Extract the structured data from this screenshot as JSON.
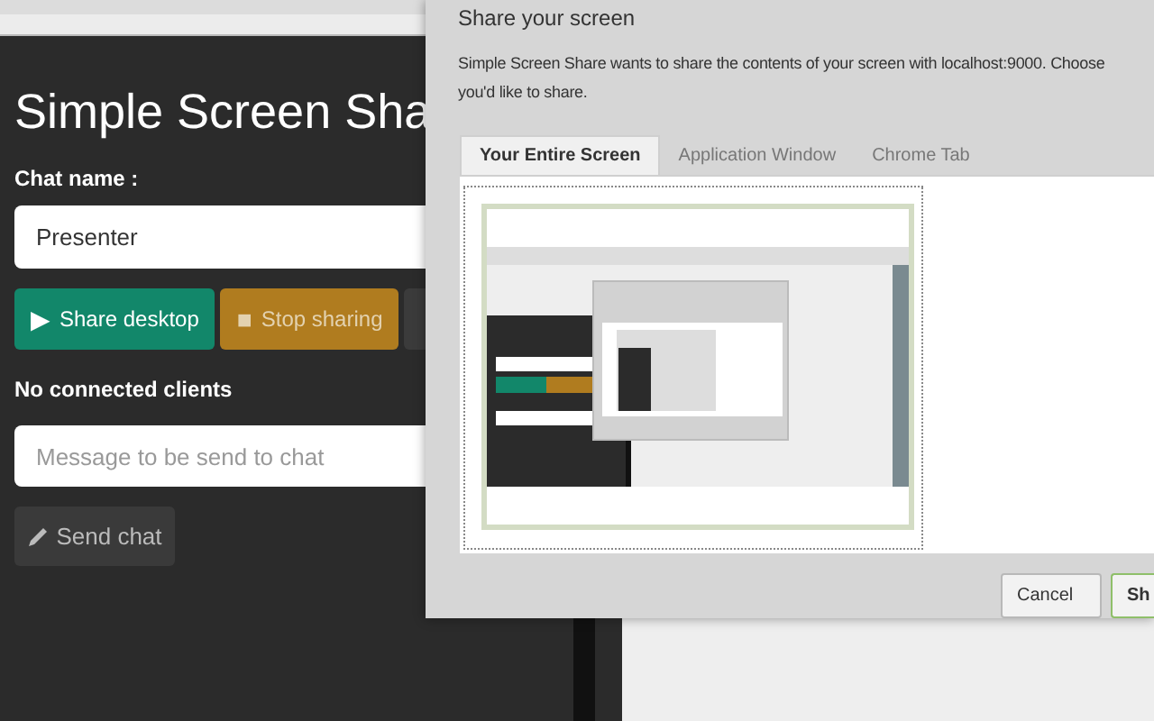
{
  "app": {
    "title": "Simple Screen Sha",
    "chat_name_label": "Chat name :",
    "chat_name_value": "Presenter",
    "buttons": [
      {
        "kind": "share",
        "label": "Share desktop",
        "icon": "▶"
      },
      {
        "kind": "stop",
        "label": "Stop sharing",
        "icon": "■"
      },
      {
        "kind": "other"
      }
    ],
    "clients_status": "No connected clients",
    "message_placeholder": "Message to be send to chat",
    "send_button": "Send chat"
  },
  "dialog": {
    "title": "Share your screen",
    "description": [
      "Simple Screen Share wants to share the contents of your screen with localhost:9000. Choose",
      "you'd like to share."
    ],
    "tabs": [
      {
        "label": "Your Entire Screen",
        "selected": true
      },
      {
        "label": "Application Window",
        "selected": false
      },
      {
        "label": "Chrome Tab",
        "selected": false
      }
    ],
    "buttons": [
      {
        "label": "Cancel",
        "kind": "cancel"
      },
      {
        "label": "Sh",
        "kind": "share"
      }
    ]
  }
}
